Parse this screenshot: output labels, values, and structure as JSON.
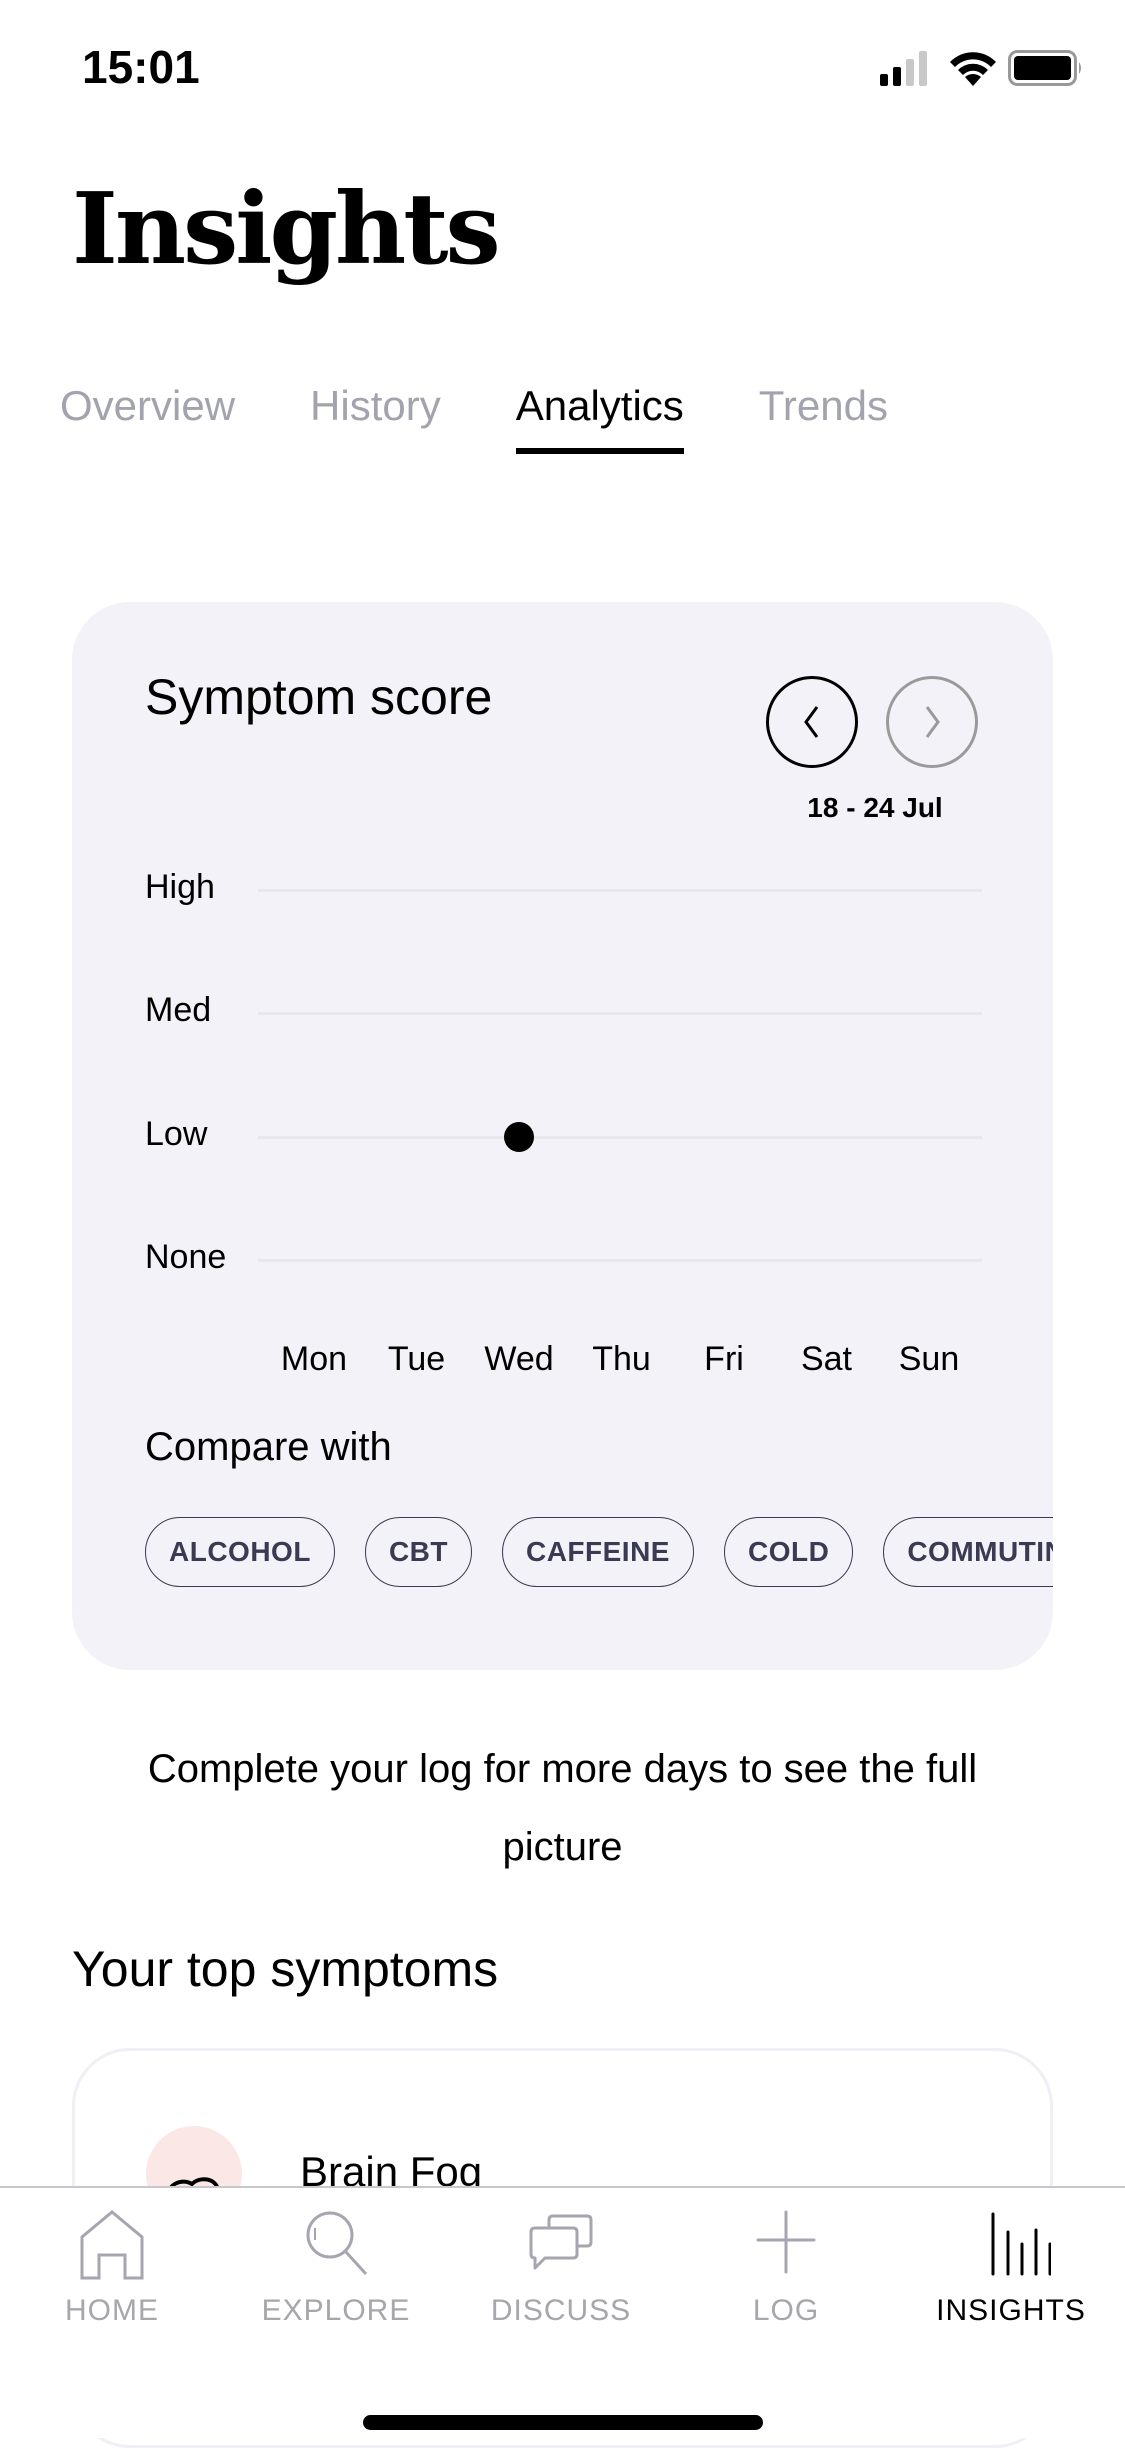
{
  "status_bar": {
    "time": "15:01",
    "icons": [
      "cellular-signal-icon",
      "wifi-icon",
      "battery-icon"
    ]
  },
  "header": {
    "title": "Insights"
  },
  "tabs": [
    {
      "label": "Overview",
      "active": false
    },
    {
      "label": "History",
      "active": false
    },
    {
      "label": "Analytics",
      "active": true
    },
    {
      "label": "Trends",
      "active": false
    }
  ],
  "symptom_card": {
    "title": "Symptom score",
    "prev_icon": "chevron-left-icon",
    "next_icon": "chevron-right-icon",
    "date_range": "18 - 24 Jul",
    "compare_label": "Compare with",
    "chips": [
      "ALCOHOL",
      "CBT",
      "CAFFEINE",
      "COLD",
      "COMMUTING"
    ]
  },
  "chart_data": {
    "type": "scatter",
    "title": "Symptom score",
    "xlabel": "",
    "ylabel": "",
    "categories": [
      "Mon",
      "Tue",
      "Wed",
      "Thu",
      "Fri",
      "Sat",
      "Sun"
    ],
    "y_levels": [
      "None",
      "Low",
      "Med",
      "High"
    ],
    "ylim": [
      0,
      3
    ],
    "grid": true,
    "series": [
      {
        "name": "Symptom score",
        "points": [
          {
            "x": "Wed",
            "y": "Low"
          }
        ]
      }
    ]
  },
  "hint_text": "Complete your log for more days to see the full picture",
  "top_symptoms": {
    "title": "Your top symptoms",
    "items": [
      {
        "name": "Brain Fog",
        "icon": "brain-icon",
        "icon_bg": "#fbe8e6"
      }
    ]
  },
  "tab_bar": {
    "items": [
      {
        "label": "HOME",
        "icon": "home-icon",
        "active": false
      },
      {
        "label": "EXPLORE",
        "icon": "search-icon",
        "active": false
      },
      {
        "label": "DISCUSS",
        "icon": "chat-bubbles-icon",
        "active": false
      },
      {
        "label": "LOG",
        "icon": "plus-icon",
        "active": false
      },
      {
        "label": "INSIGHTS",
        "icon": "bar-chart-icon",
        "active": true
      }
    ]
  },
  "colors": {
    "card_bg": "#f3f2f8",
    "inactive": "#a3a3ae",
    "chip_text": "#3a3a52",
    "gridline": "#e8e7ec"
  }
}
